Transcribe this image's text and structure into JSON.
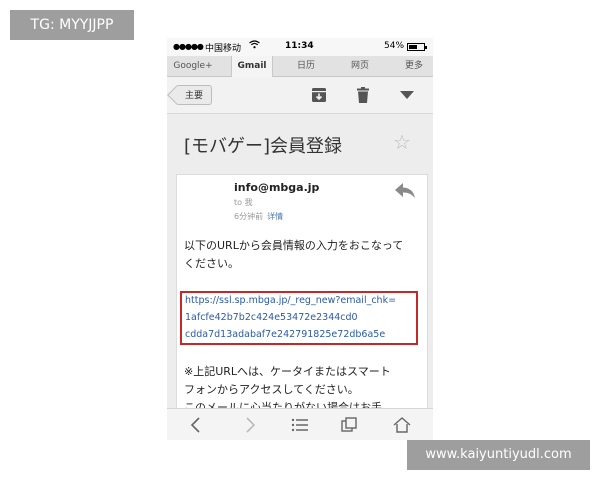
{
  "overlay": {
    "top_left_tag": "TG: MYYJJPP",
    "bottom_right_tag": "www.kaiyuntiyudl.com"
  },
  "statusbar": {
    "signal": "●●●●●",
    "carrier": "中国移动",
    "time": "11:34",
    "battery": "54%"
  },
  "tabs": [
    {
      "label": "Google+"
    },
    {
      "label": "Gmail",
      "active": true
    },
    {
      "label": "日历"
    },
    {
      "label": "网页"
    },
    {
      "label": "更多"
    }
  ],
  "toolbar": {
    "back_label": "主要",
    "icons": [
      "archive-icon",
      "trash-icon",
      "dropdown-icon"
    ]
  },
  "email": {
    "subject": "[モバゲー]会員登録",
    "sender": "info@mbga.jp",
    "to": "to 我",
    "time_ago": "6分钟前",
    "details_link": "详情",
    "body_lines": [
      "以下のURLから会員情報の入力をおこなって",
      "ください。"
    ],
    "link_lines": [
      "https://ssl.sp.mbga.jp/_reg_new?email_chk=",
      "1afcfe42b7b2c424e53472e2344cd0",
      "cdda7d13adabaf7e242791825e72db6a5e"
    ],
    "footer_lines": [
      "※上記URLへは、ケータイまたはスマート",
      "フォンからアクセスしてください。",
      "このメールに心当たりがない場合はお手"
    ]
  },
  "colors": {
    "link": "#2a5aa7",
    "highlight_border": "#c62828",
    "overlay_tag": "#9e9e9e"
  }
}
